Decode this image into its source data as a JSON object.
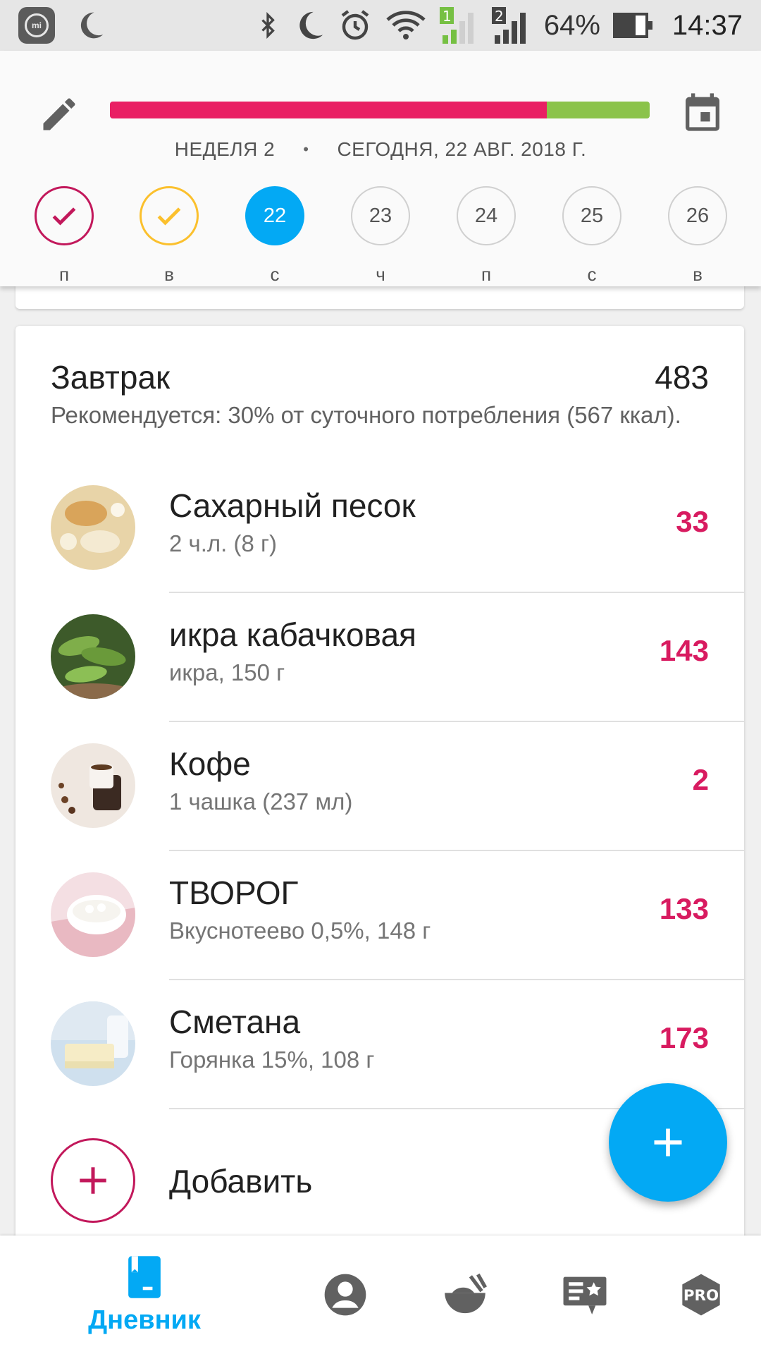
{
  "status_bar": {
    "battery": "64%",
    "time": "14:37",
    "icons": [
      "mi-icon",
      "moon-icon",
      "bluetooth-icon",
      "moon-icon",
      "alarm-icon",
      "wifi-icon",
      "signal-sim1-icon",
      "signal-sim2-icon",
      "battery-icon"
    ]
  },
  "header": {
    "progress_consumed_fraction": 0.81,
    "week": "НЕДЕЛЯ 2",
    "separator": "•",
    "today": "СЕГОДНЯ, 22 АВГ. 2018 Г.",
    "days": [
      {
        "number": "",
        "label": "п",
        "state": "over"
      },
      {
        "number": "",
        "label": "в",
        "state": "near"
      },
      {
        "number": "22",
        "label": "с",
        "state": "today"
      },
      {
        "number": "23",
        "label": "ч",
        "state": "future"
      },
      {
        "number": "24",
        "label": "п",
        "state": "future"
      },
      {
        "number": "25",
        "label": "с",
        "state": "future"
      },
      {
        "number": "26",
        "label": "в",
        "state": "future"
      }
    ],
    "colors": {
      "over": "#e91e63",
      "remaining": "#8bc34a",
      "today": "#03a9f4",
      "near": "#fbc02d"
    }
  },
  "meal": {
    "title": "Завтрак",
    "total": "483",
    "recommendation": "Рекомендуется: 30% от суточного потребления (567 ккал).",
    "foods": [
      {
        "name": "Сахарный песок",
        "detail": "2 ч.л. (8 г)",
        "calories": "33",
        "image": "sugar-photo"
      },
      {
        "name": "икра кабачковая",
        "detail": "икра, 150 г",
        "calories": "143",
        "image": "cucumbers-photo"
      },
      {
        "name": "Кофе",
        "detail": "1 чашка (237 мл)",
        "calories": "2",
        "image": "coffee-photo"
      },
      {
        "name": "ТВОРОГ",
        "detail": "Вкуснотеево 0,5%, 148 г",
        "calories": "133",
        "image": "cottage-cheese-photo"
      },
      {
        "name": "Сметана",
        "detail": "Горянка 15%, 108 г",
        "calories": "173",
        "image": "sour-cream-photo"
      }
    ],
    "add_label": "Добавить"
  },
  "bottom_nav": {
    "diary_label": "Дневник",
    "items": [
      "diary-icon",
      "profile-icon",
      "recipes-icon",
      "plans-icon",
      "pro-icon"
    ],
    "pro_text": "PRO"
  }
}
